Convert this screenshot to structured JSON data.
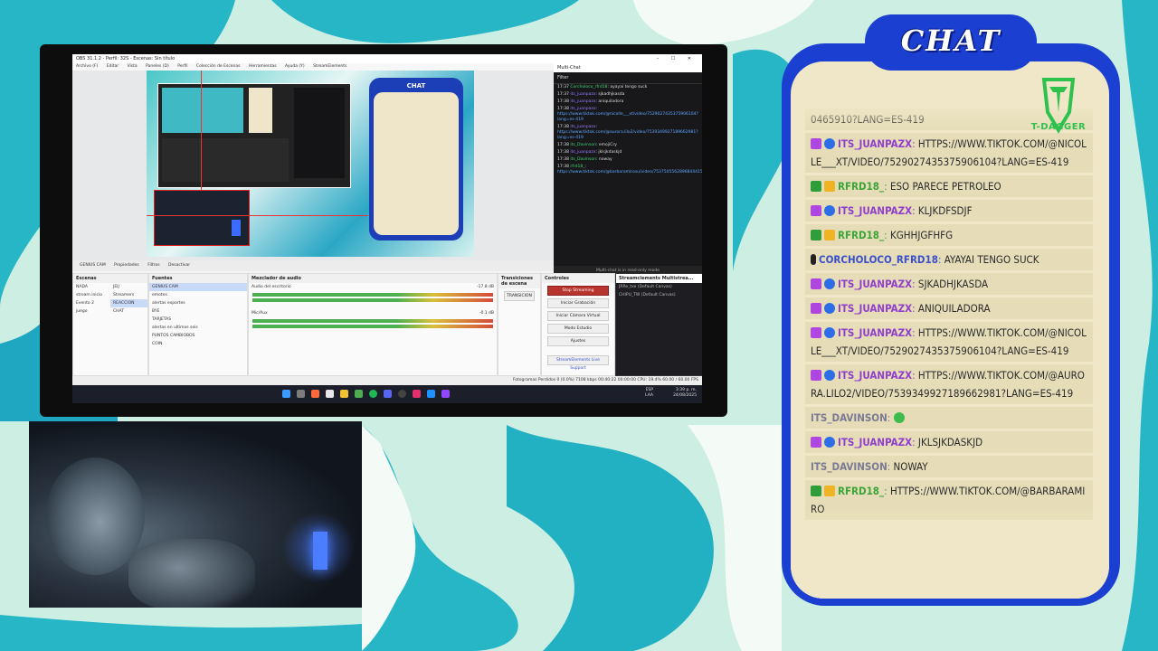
{
  "colors": {
    "accent_blue": "#1b3fd0",
    "paper": "#efe7c7",
    "teal": "#27b6c6",
    "lightgreen": "#cbeee2",
    "obs_stop": "#b8342f"
  },
  "obs": {
    "window_title": "OBS 31.1.2 - Perfil: 32S - Escenas: Sin título",
    "menu": [
      "Archivo (F)",
      "Editar",
      "Vista",
      "Paneles (D)",
      "Perfil",
      "Colección de Escenas",
      "Herramientas",
      "Ayuda (Y)",
      "StreamElements"
    ],
    "source_bar": {
      "cam_name": "GENIUS CAM",
      "props": "Propiedades",
      "filters": "Filtros",
      "disable": "Desactivar"
    },
    "docks": {
      "scenes": {
        "title": "Escenas",
        "items": [
          "NADA",
          "JEIJ",
          "stream inicio",
          "Streamers",
          "Evento 2",
          "REACCION",
          "juego",
          "CHAT"
        ]
      },
      "sources": {
        "title": "Fuentes",
        "items": [
          "GENIUS CAM",
          "emotes",
          "alertas exportes",
          "BYE",
          "TARJETAS",
          "alertas en ultimos seis",
          "PUNTOS CAMBIOBOS",
          "COIN"
        ]
      },
      "mixer": {
        "title": "Mezclador de audio",
        "ch1": "Audio del escritorio",
        "ch1_db": "-17.8 dB",
        "ch2": "Mic/Aux",
        "ch2_db": "-0.1 dB"
      },
      "transitions": {
        "title": "Transiciones de escena",
        "value": "TRANSICION"
      },
      "controls": {
        "title": "Controles",
        "buttons": [
          "Stop Streaming",
          "Iniciar Grabación",
          "Iniciar Cámara Virtual",
          "Modo Estudio",
          "Ajustes"
        ],
        "extra": "StreamElements Live Support"
      },
      "multistream": {
        "title": "Streamclements Multistrea...",
        "item1": "JRRe_txe (Default Canvas)",
        "item2": "CHIPU_TW (Default Canvas)"
      }
    },
    "status": "Fotogramas Perdidos 0 (0.0%)   7108 kbps   00:40:22   00:00:00   CPU: 19.4%   60.00 / 60.00 FPS",
    "clock": {
      "time": "3:39 p. m.",
      "date": "24/08/2025",
      "lang": "ESP LAA"
    },
    "multichat": {
      "title": "Multi-Chat",
      "filter": "Filter",
      "footer": "Multi-chat is in read-only mode",
      "lines": [
        {
          "time": "17:37",
          "user": "Corcholoco_rfrd18",
          "text": "ayayai tengo suck",
          "ucls": "g"
        },
        {
          "time": "17:37",
          "user": "its_juanpazx",
          "text": "sjkadhjkasda",
          "ucls": "u"
        },
        {
          "time": "17:38",
          "user": "its_juanpazx",
          "text": "aniquiladora",
          "ucls": "u"
        },
        {
          "time": "17:38",
          "user": "its_juanpazx",
          "text": "https://www.tiktok.com/@nicolle___xt/video/7529027435375906104?lang=es-419",
          "ucls": "u"
        },
        {
          "time": "17:38",
          "user": "its_juanpazx",
          "text": "https://www.tiktok.com/@aurora.lilo2/video/7539349927189662981?lang=es-419",
          "ucls": "u"
        },
        {
          "time": "17:38",
          "user": "its_Davinson",
          "text": "emojiCry",
          "ucls": "g"
        },
        {
          "time": "17:38",
          "user": "its_juanpazx",
          "text": "jklsjkdaskjd",
          "ucls": "u"
        },
        {
          "time": "17:38",
          "user": "its_Davinson",
          "text": "noway",
          "ucls": "g"
        },
        {
          "time": "17:38",
          "user": "rfrd18_",
          "text": "https://www.tiktok.com/@barbaramirosu/video/75375055628968444157is_from_webapp=1&sender_device=pc&web_id=75395679746307902984",
          "ucls": "g"
        }
      ]
    }
  },
  "chat": {
    "title": "CHAT",
    "logo_text": "T-DAGGER",
    "messages": [
      {
        "user": "",
        "text": "0465910?LANG=ES-419",
        "ucls": "u-gray"
      },
      {
        "user": "ITS_JUANPAZX",
        "text": "HTTPS://WWW.TIKTOK.COM/@NICOLLE___XT/VIDEO/7529027435375906104?LANG=ES-419",
        "ucls": "u-purple",
        "badges": [
          "b-purple",
          "b-check"
        ]
      },
      {
        "user": "RFRD18_",
        "text": "ESO PARECE PETROLEO",
        "ucls": "u-green",
        "badges": [
          "b-green",
          "b-crown"
        ]
      },
      {
        "user": "ITS_JUANPAZX",
        "text": "KLJKDFSDJF",
        "ucls": "u-purple",
        "badges": [
          "b-purple",
          "b-check"
        ]
      },
      {
        "user": "RFRD18_",
        "text": "KGHHJGFHFG",
        "ucls": "u-green",
        "badges": [
          "b-green",
          "b-crown"
        ]
      },
      {
        "user": "CORCHOLOCO_RFRD18",
        "text": "AYAYAI TENGO SUCK",
        "ucls": "u-blue",
        "badges": [
          "b-mic"
        ]
      },
      {
        "user": "ITS_JUANPAZX",
        "text": "SJKADHJKASDA",
        "ucls": "u-purple",
        "badges": [
          "b-purple",
          "b-check"
        ]
      },
      {
        "user": "ITS_JUANPAZX",
        "text": "ANIQUILADORA",
        "ucls": "u-purple",
        "badges": [
          "b-purple",
          "b-check"
        ]
      },
      {
        "user": "ITS_JUANPAZX",
        "text": "HTTPS://WWW.TIKTOK.COM/@NICOLLE___XT/VIDEO/7529027435375906104?LANG=ES-419",
        "ucls": "u-purple",
        "badges": [
          "b-purple",
          "b-check"
        ]
      },
      {
        "user": "ITS_JUANPAZX",
        "text": "HTTPS://WWW.TIKTOK.COM/@AURORA.LILO2/VIDEO/7539349927189662981?LANG=ES-419",
        "ucls": "u-purple",
        "badges": [
          "b-purple",
          "b-check"
        ]
      },
      {
        "user": "ITS_DAVINSON",
        "text": "",
        "ucls": "u-gray",
        "emoji": true
      },
      {
        "user": "ITS_JUANPAZX",
        "text": "JKLSJKDASKJD",
        "ucls": "u-purple",
        "badges": [
          "b-purple",
          "b-check"
        ]
      },
      {
        "user": "ITS_DAVINSON",
        "text": "NOWAY",
        "ucls": "u-gray"
      },
      {
        "user": "RFRD18_",
        "text": "HTTPS://WWW.TIKTOK.COM/@BARBARAMIRO",
        "ucls": "u-green",
        "badges": [
          "b-green",
          "b-crown"
        ]
      }
    ]
  }
}
